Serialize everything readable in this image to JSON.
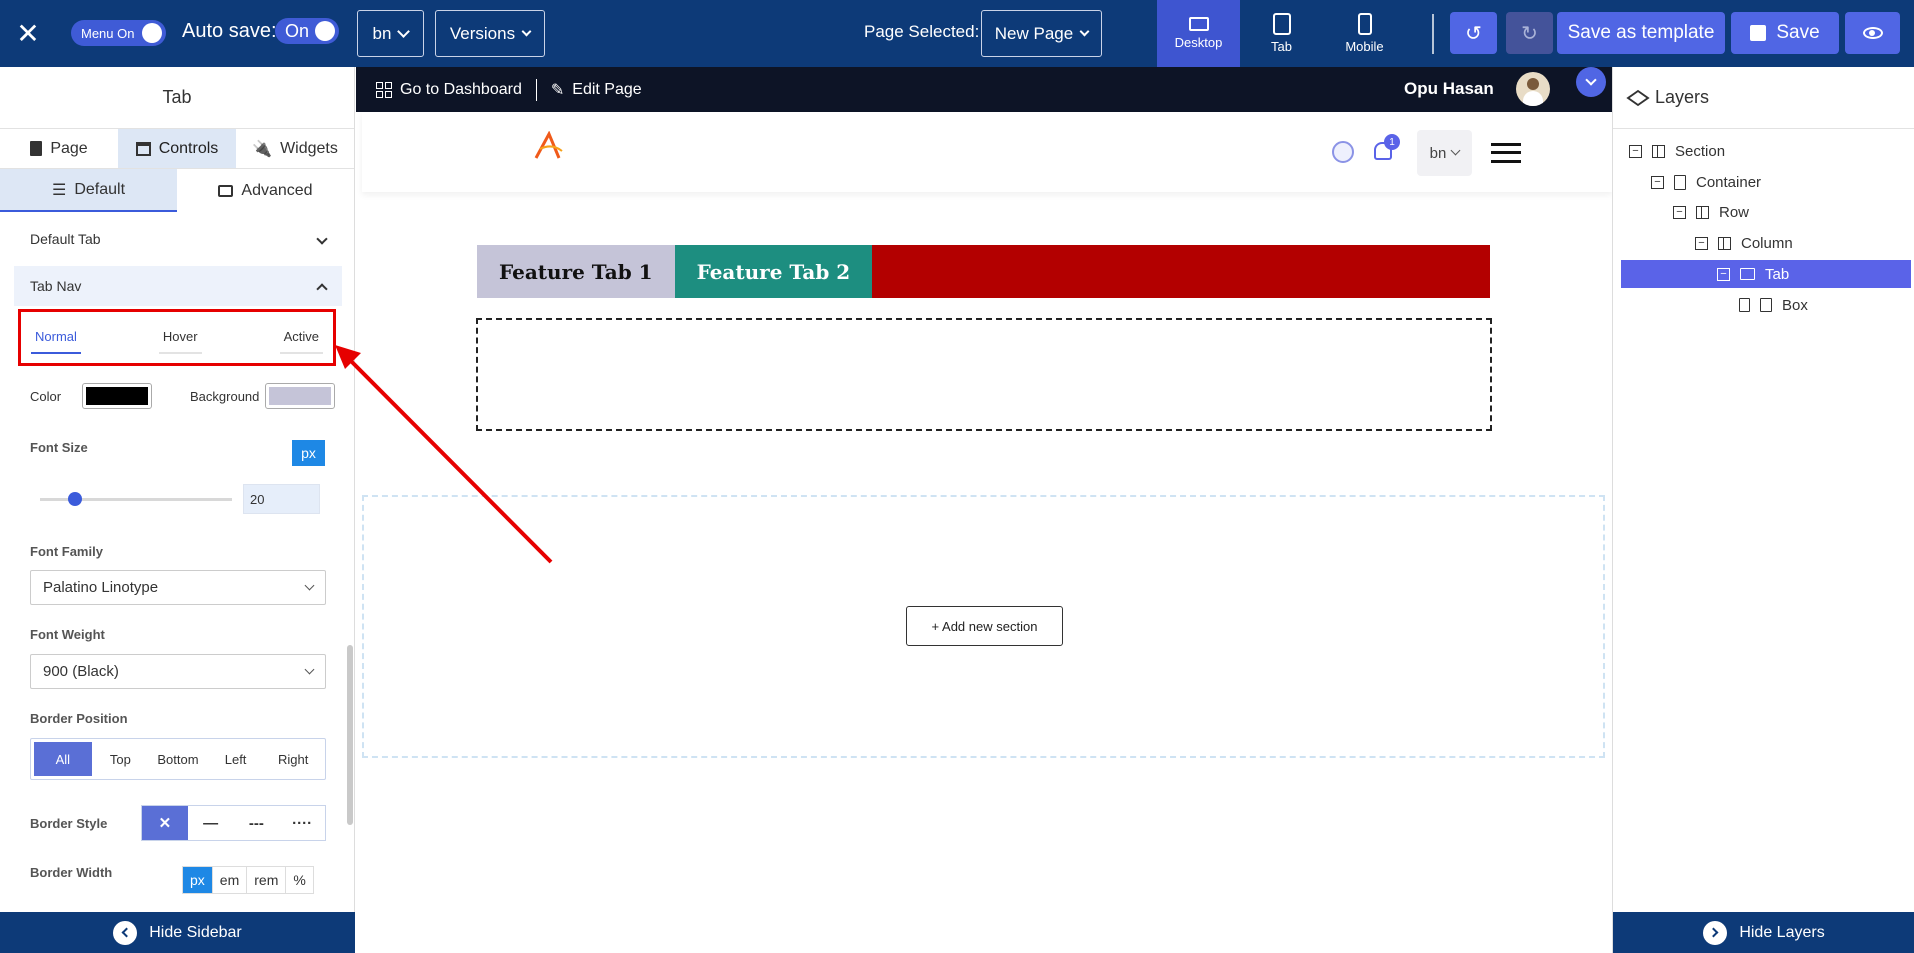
{
  "topbar": {
    "menu_toggle_label": "Menu On",
    "autosave_label": "Auto save:",
    "autosave_value": "On",
    "language": "bn",
    "versions_label": "Versions",
    "page_selected_label": "Page Selected:",
    "page_selected_value": "New Page",
    "devices": [
      {
        "label": "Desktop",
        "active": true
      },
      {
        "label": "Tab",
        "active": false
      },
      {
        "label": "Mobile",
        "active": false
      }
    ],
    "save_template_label": "Save as template",
    "save_label": "Save"
  },
  "sidebar": {
    "title": "Tab",
    "tabs": [
      {
        "label": "Page",
        "icon": "document-icon",
        "active": false
      },
      {
        "label": "Controls",
        "icon": "layout-icon",
        "active": true
      },
      {
        "label": "Widgets",
        "icon": "plug-icon",
        "active": false
      }
    ],
    "subtabs": [
      {
        "label": "Default",
        "icon": "list-icon",
        "active": true
      },
      {
        "label": "Advanced",
        "icon": "monitor-icon",
        "active": false
      }
    ],
    "accordions": {
      "default_tab": "Default Tab",
      "tab_nav": "Tab Nav"
    },
    "states": [
      {
        "label": "Normal",
        "active": true
      },
      {
        "label": "Hover",
        "active": false
      },
      {
        "label": "Active",
        "active": false
      }
    ],
    "color_label": "Color",
    "color_value": "#000000",
    "background_label": "Background",
    "background_value": "#c5c4d8",
    "font_size_label": "Font Size",
    "font_size_unit": "px",
    "font_size_value": "20",
    "font_size_slider_fraction": 0.18,
    "font_family_label": "Font Family",
    "font_family_value": "Palatino Linotype",
    "font_weight_label": "Font Weight",
    "font_weight_value": "900 (Black)",
    "border_position_label": "Border Position",
    "border_positions": [
      "All",
      "Top",
      "Bottom",
      "Left",
      "Right"
    ],
    "border_style_label": "Border Style",
    "border_styles": [
      "✕",
      "—",
      "---",
      "····"
    ],
    "border_width_label": "Border Width",
    "border_width_units": [
      "px",
      "em",
      "rem",
      "%"
    ],
    "hide_sidebar_label": "Hide Sidebar"
  },
  "canvas": {
    "go_dashboard_label": "Go to Dashboard",
    "edit_page_label": "Edit Page",
    "user_name": "Opu Hasan",
    "notification_count": "1",
    "header_language": "bn",
    "tabs": [
      "Feature Tab 1",
      "Feature Tab 2"
    ],
    "add_section_label": "+ Add new section"
  },
  "layers": {
    "title": "Layers",
    "items": [
      {
        "label": "Section",
        "icon": "column-icon"
      },
      {
        "label": "Container",
        "icon": "container-icon"
      },
      {
        "label": "Row",
        "icon": "column-icon"
      },
      {
        "label": "Column",
        "icon": "column-icon"
      },
      {
        "label": "Tab",
        "icon": "folder-icon",
        "selected": true
      },
      {
        "label": "Box",
        "icon": "box-icon"
      }
    ],
    "hide_layers_label": "Hide Layers"
  },
  "colors": {
    "topbar": "#0d3a78",
    "accent": "#5066e4",
    "annotation": "#e60000",
    "tab_strip": "#b30000",
    "tab2_bg": "#1d8e80"
  }
}
